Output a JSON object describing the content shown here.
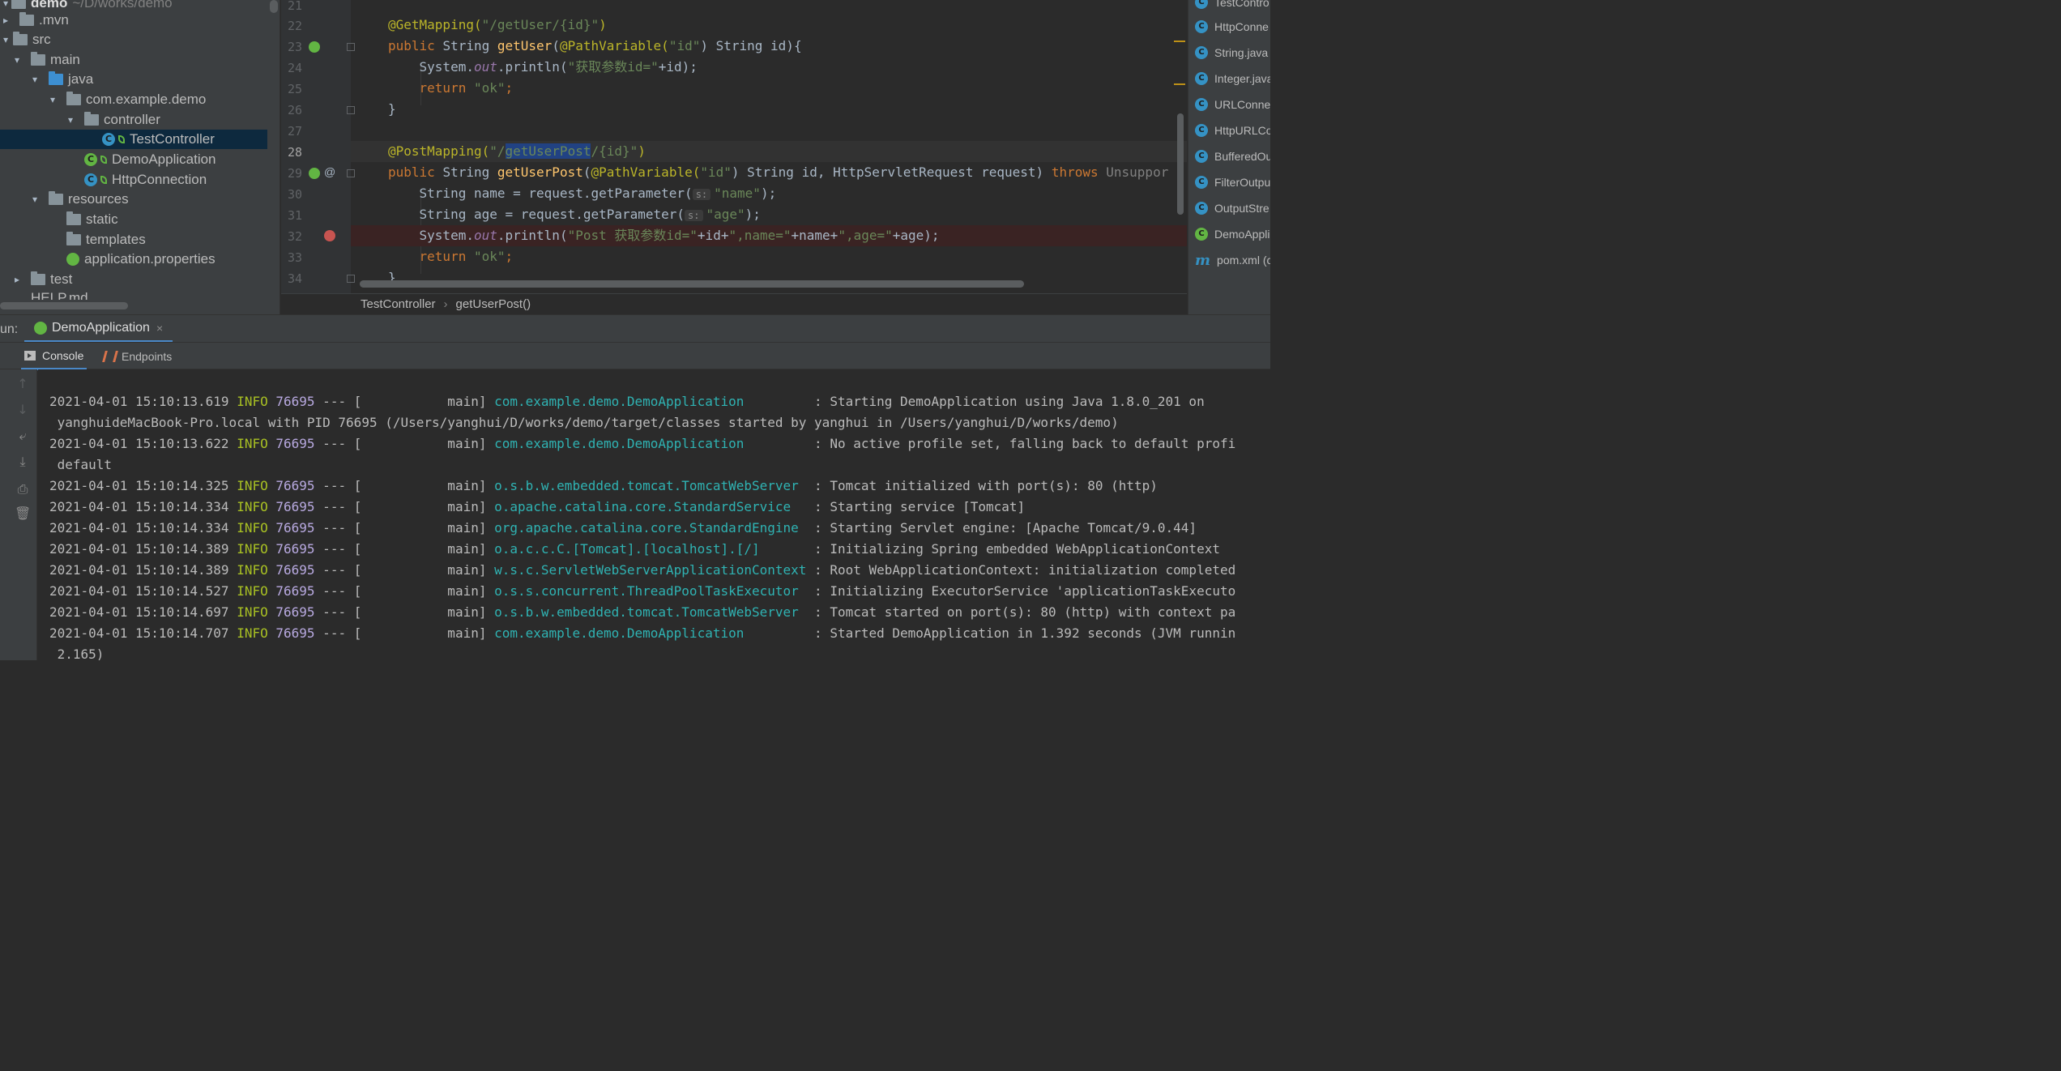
{
  "project_tree": {
    "root_name": "demo",
    "root_path": "~/D/works/demo",
    "items": [
      {
        "label": ".mvn",
        "arrow": "▸"
      },
      {
        "label": "src",
        "arrow": "▾"
      },
      {
        "label": "main",
        "arrow": "▾"
      },
      {
        "label": "java",
        "arrow": "▾"
      },
      {
        "label": "com.example.demo",
        "arrow": "▾"
      },
      {
        "label": "controller",
        "arrow": "▾"
      },
      {
        "label": "TestController"
      },
      {
        "label": "DemoApplication"
      },
      {
        "label": "HttpConnection"
      },
      {
        "label": "resources",
        "arrow": "▾"
      },
      {
        "label": "static"
      },
      {
        "label": "templates"
      },
      {
        "label": "application.properties"
      },
      {
        "label": "test",
        "arrow": "▸"
      },
      {
        "label": "HELP.md"
      }
    ]
  },
  "editor": {
    "line_numbers": [
      "21",
      "22",
      "23",
      "24",
      "25",
      "26",
      "27",
      "28",
      "29",
      "30",
      "31",
      "32",
      "33",
      "34"
    ],
    "current_line": "28",
    "hints": {
      "s": "s:"
    }
  },
  "breadcrumb": {
    "file": "TestController",
    "method": "getUserPost()",
    "separator": "›"
  },
  "recent_files": [
    "TestContro",
    "HttpConne",
    "String.java",
    "Integer.java",
    "URLConne",
    "HttpURLCo",
    "BufferedOu",
    "FilterOutpu",
    "OutputStre",
    "DemoAppli",
    "pom.xml (c"
  ],
  "run_panel": {
    "label": "un:",
    "tab": "DemoApplication",
    "close": "×",
    "subtabs": {
      "console": "Console",
      "endpoints": "Endpoints"
    }
  },
  "toolbar_icons": [
    "arrow-up-icon",
    "arrow-down-icon",
    "soft-wrap-icon",
    "scroll-to-end-icon",
    "print-icon",
    "trash-icon"
  ],
  "console": {
    "lines": [
      {
        "ts": "2021-04-01 15:10:13.619",
        "lvl": "INFO",
        "pid": "76695",
        "mid": " --- [           main] ",
        "logger": "com.example.demo.DemoApplication        ",
        "msg": " : Starting DemoApplication using Java 1.8.0_201 on"
      },
      {
        "cont": " yanghuideMacBook-Pro.local with PID 76695 (/Users/yanghui/D/works/demo/target/classes started by yanghui in /Users/yanghui/D/works/demo)"
      },
      {
        "ts": "2021-04-01 15:10:13.622",
        "lvl": "INFO",
        "pid": "76695",
        "mid": " --- [           main] ",
        "logger": "com.example.demo.DemoApplication        ",
        "msg": " : No active profile set, falling back to default profi"
      },
      {
        "cont": " default"
      },
      {
        "ts": "2021-04-01 15:10:14.325",
        "lvl": "INFO",
        "pid": "76695",
        "mid": " --- [           main] ",
        "logger": "o.s.b.w.embedded.tomcat.TomcatWebServer ",
        "msg": " : Tomcat initialized with port(s): 80 (http)"
      },
      {
        "ts": "2021-04-01 15:10:14.334",
        "lvl": "INFO",
        "pid": "76695",
        "mid": " --- [           main] ",
        "logger": "o.apache.catalina.core.StandardService  ",
        "msg": " : Starting service [Tomcat]"
      },
      {
        "ts": "2021-04-01 15:10:14.334",
        "lvl": "INFO",
        "pid": "76695",
        "mid": " --- [           main] ",
        "logger": "org.apache.catalina.core.StandardEngine ",
        "msg": " : Starting Servlet engine: [Apache Tomcat/9.0.44]"
      },
      {
        "ts": "2021-04-01 15:10:14.389",
        "lvl": "INFO",
        "pid": "76695",
        "mid": " --- [           main] ",
        "logger": "o.a.c.c.C.[Tomcat].[localhost].[/]      ",
        "msg": " : Initializing Spring embedded WebApplicationContext"
      },
      {
        "ts": "2021-04-01 15:10:14.389",
        "lvl": "INFO",
        "pid": "76695",
        "mid": " --- [           main] ",
        "logger": "w.s.c.ServletWebServerApplicationContext",
        "msg": " : Root WebApplicationContext: initialization completed"
      },
      {
        "ts": "2021-04-01 15:10:14.527",
        "lvl": "INFO",
        "pid": "76695",
        "mid": " --- [           main] ",
        "logger": "o.s.s.concurrent.ThreadPoolTaskExecutor ",
        "msg": " : Initializing ExecutorService 'applicationTaskExecuto"
      },
      {
        "ts": "2021-04-01 15:10:14.697",
        "lvl": "INFO",
        "pid": "76695",
        "mid": " --- [           main] ",
        "logger": "o.s.b.w.embedded.tomcat.TomcatWebServer ",
        "msg": " : Tomcat started on port(s): 80 (http) with context pa"
      },
      {
        "ts": "2021-04-01 15:10:14.707",
        "lvl": "INFO",
        "pid": "76695",
        "mid": " --- [           main] ",
        "logger": "com.example.demo.DemoApplication        ",
        "msg": " : Started DemoApplication in 1.392 seconds (JVM runnin"
      },
      {
        "cont": " 2.165)"
      }
    ]
  },
  "code": {
    "l22": {
      "ann": "@GetMapping(",
      "str": "\"/getUser/{id}\"",
      "end": ")"
    },
    "l23": {
      "kw": "public ",
      "t1": "String ",
      "fn": "getUser",
      "t2": "(",
      "ann": "@PathVariable(",
      "str": "\"id\"",
      "t3": ") String id){"
    },
    "l24": {
      "t1": "    System.",
      "st": "out",
      "t2": ".println(",
      "str": "\"获取参数id=\"",
      "t3": "+id);"
    },
    "l25": {
      "kw": "    return ",
      "str": "\"ok\"",
      "t1": ";"
    },
    "l26": {
      "t1": "}"
    },
    "l28": {
      "ann": "@PostMapping(",
      "s1": "\"/",
      "sel": "getUserPost",
      "s2": "/{id}\"",
      "end": ")"
    },
    "l29": {
      "kw": "public ",
      "t1": "String ",
      "fn": "getUserPost",
      "t2": "(",
      "ann": "@PathVariable(",
      "str": "\"id\"",
      "t3": ") String id, HttpServletRequest request) ",
      "kw2": "throws ",
      "t4": "Unsuppor"
    },
    "l30": {
      "t1": "    String name = request.getParameter(",
      "str": "\"name\"",
      "t2": ");"
    },
    "l31": {
      "t1": "    String age = request.getParameter(",
      "str": "\"age\"",
      "t2": ");"
    },
    "l32": {
      "t1": "    System.",
      "st": "out",
      "t2": ".println(",
      "s1": "\"Post 获取参数id=\"",
      "t3": "+id+",
      "s2": "\",name=\"",
      "t4": "+name+",
      "s3": "\",age=\"",
      "t5": "+age);"
    },
    "l33": {
      "kw": "    return ",
      "str": "\"ok\"",
      "t1": ";"
    },
    "l34": {
      "t1": "}"
    }
  }
}
